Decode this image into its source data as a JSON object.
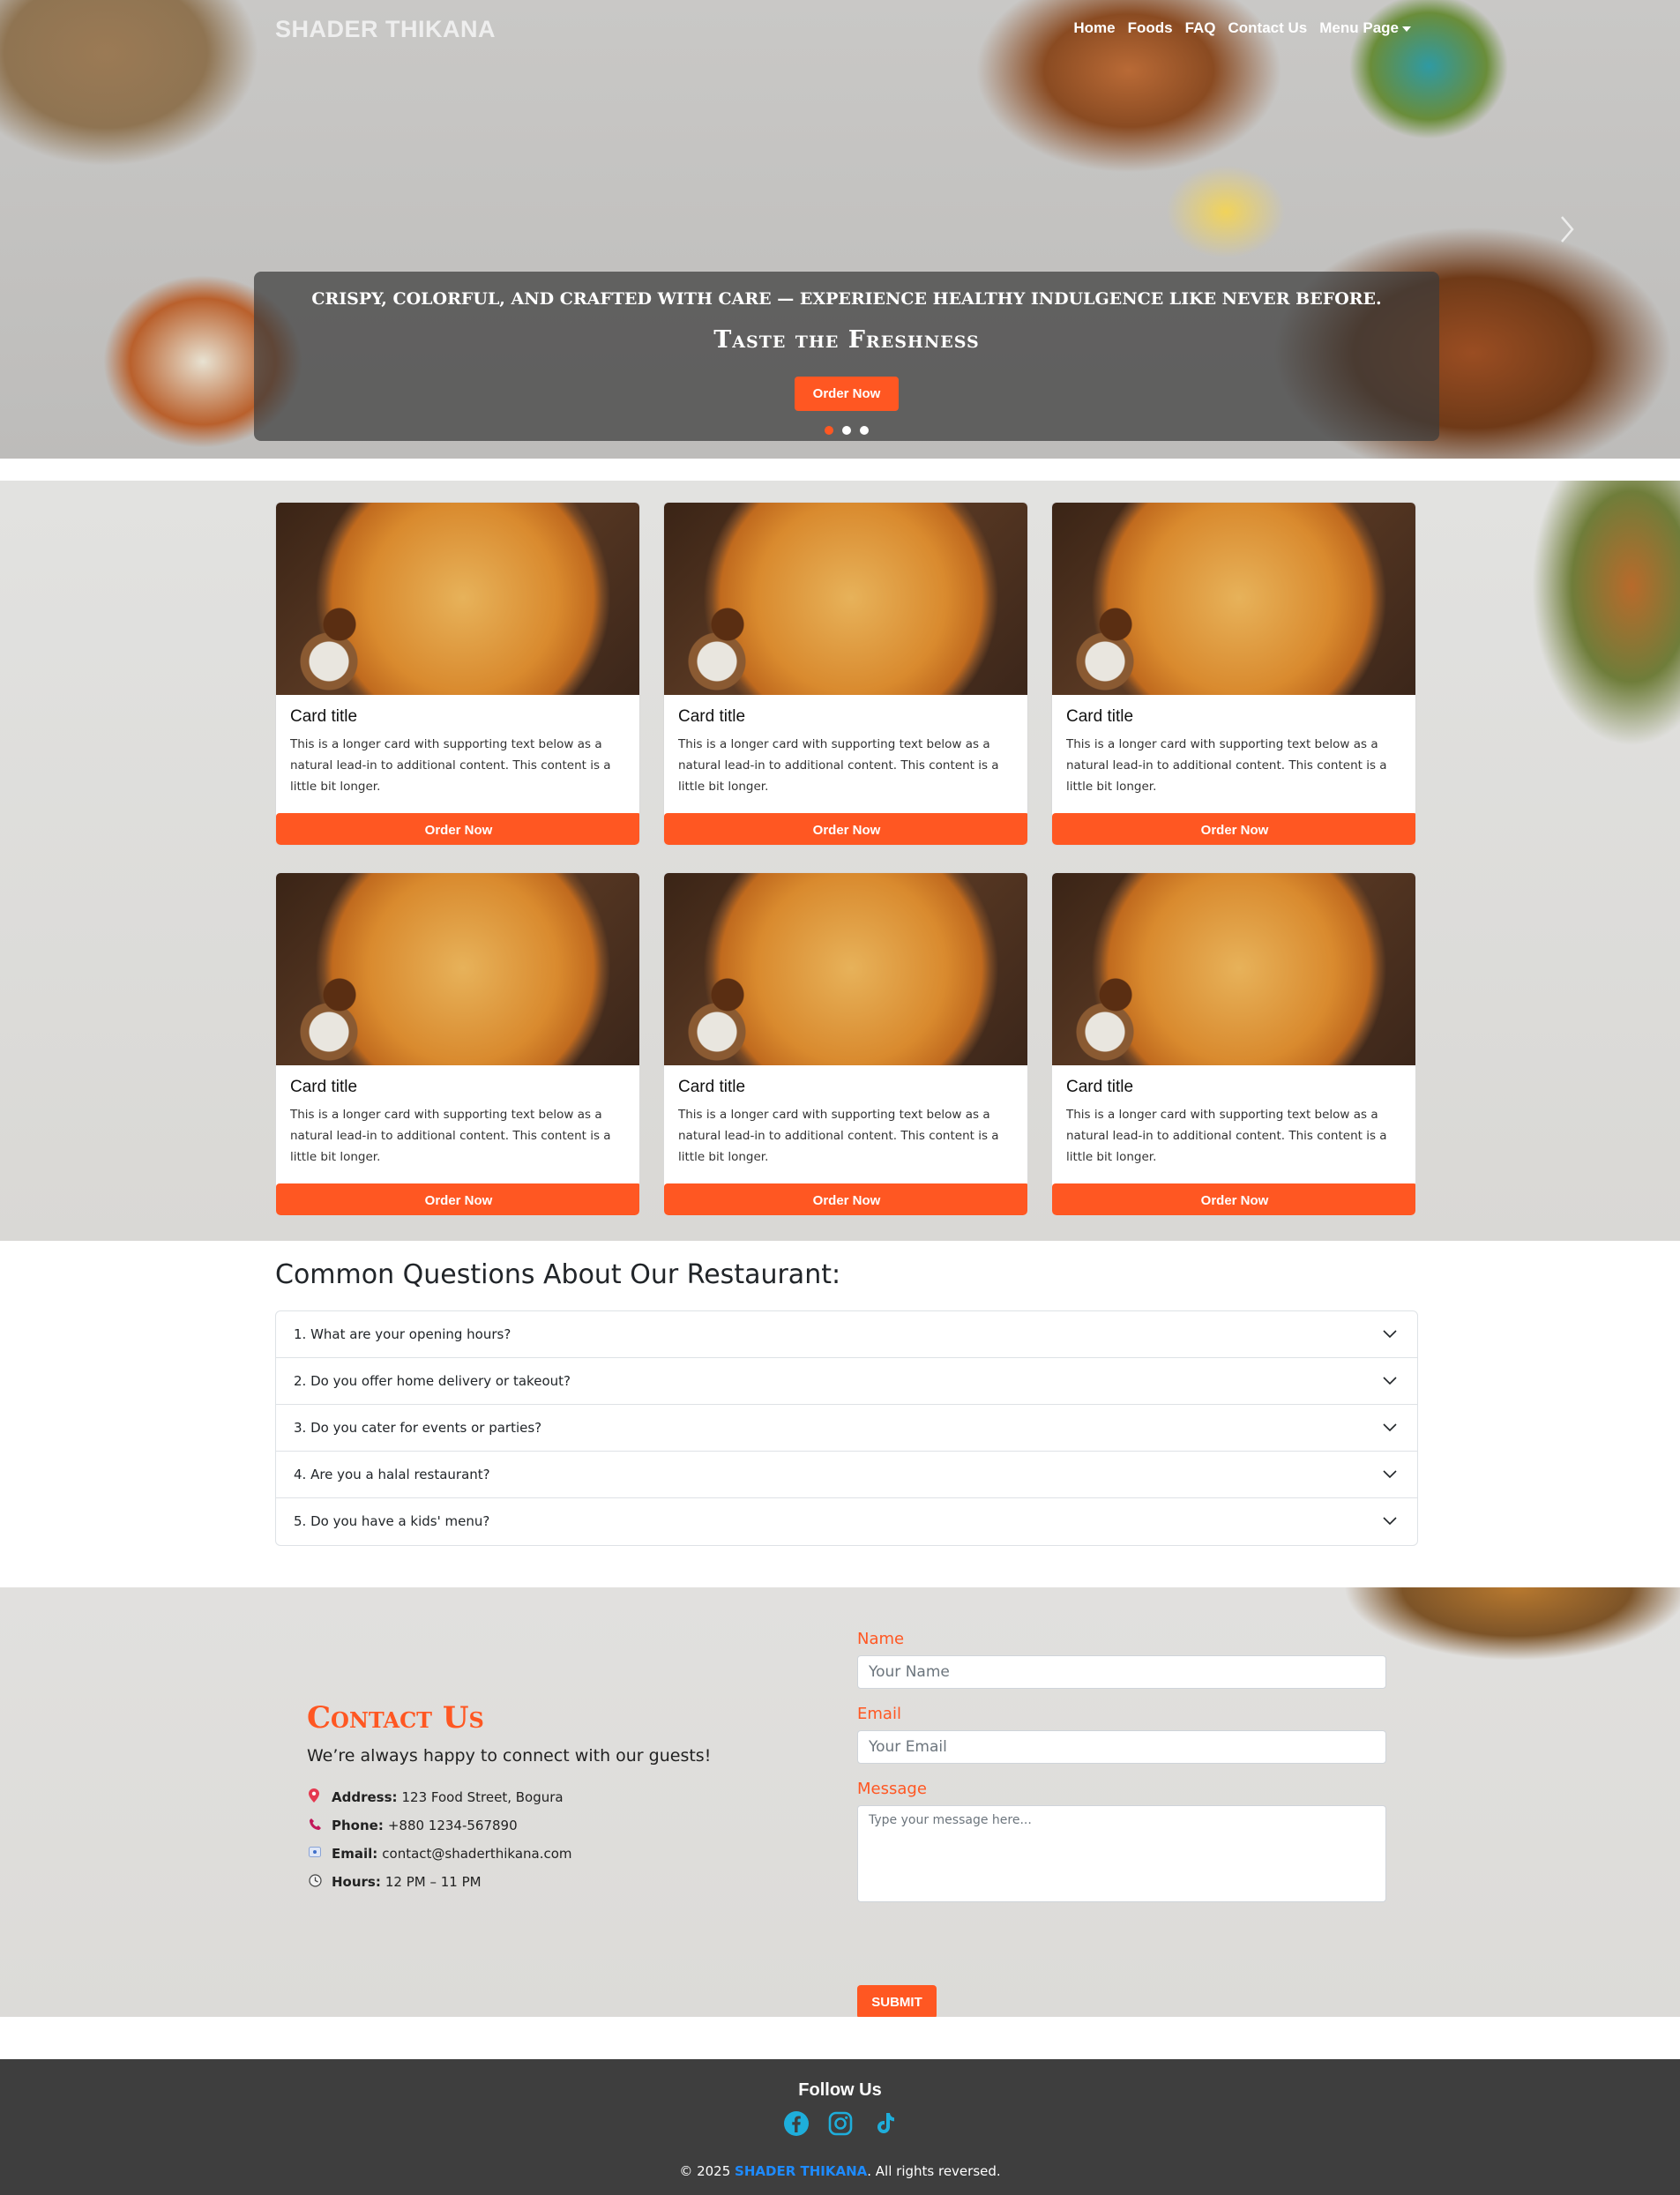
{
  "brand": "SHADER THIKANA",
  "nav": {
    "links": [
      "Home",
      "Foods",
      "FAQ",
      "Contact Us"
    ],
    "dropdown_label": "Menu Page"
  },
  "hero": {
    "caption_top": "CRISPY, COLORFUL, AND CRAFTED WITH CARE — EXPERIENCE HEALTHY INDULGENCE LIKE NEVER BEFORE.",
    "caption_title": "Taste the Freshness",
    "button": "Order Now",
    "active_slide": 1,
    "slide_count": 3
  },
  "cards": [
    {
      "title": "Card title",
      "text": "This is a longer card with supporting text below as a natural lead-in to additional content. This content is a little bit longer.",
      "button": "Order Now"
    },
    {
      "title": "Card title",
      "text": "This is a longer card with supporting text below as a natural lead-in to additional content. This content is a little bit longer.",
      "button": "Order Now"
    },
    {
      "title": "Card title",
      "text": "This is a longer card with supporting text below as a natural lead-in to additional content. This content is a little bit longer.",
      "button": "Order Now"
    },
    {
      "title": "Card title",
      "text": "This is a longer card with supporting text below as a natural lead-in to additional content. This content is a little bit longer.",
      "button": "Order Now"
    },
    {
      "title": "Card title",
      "text": "This is a longer card with supporting text below as a natural lead-in to additional content. This content is a little bit longer.",
      "button": "Order Now"
    },
    {
      "title": "Card title",
      "text": "This is a longer card with supporting text below as a natural lead-in to additional content. This content is a little bit longer.",
      "button": "Order Now"
    }
  ],
  "faq": {
    "heading": "Common Questions About Our Restaurant:",
    "questions": [
      "1. What are your opening hours?",
      "2. Do you offer home delivery or takeout?",
      "3. Do you cater for events or parties?",
      "4. Are you a halal restaurant?",
      "5. Do you have a kids' menu?"
    ]
  },
  "contact": {
    "title": "Contact Us",
    "subtitle": "We’re always happy to connect with our guests!",
    "info": [
      {
        "icon": "pin-icon",
        "label": "Address:",
        "value": "123 Food Street, Bogura"
      },
      {
        "icon": "phone-icon",
        "label": "Phone:",
        "value": "+880 1234-567890"
      },
      {
        "icon": "email-icon",
        "label": "Email:",
        "value": "contact@shaderthikana.com"
      },
      {
        "icon": "clock-icon",
        "label": "Hours:",
        "value": "12 PM – 11 PM"
      }
    ],
    "form": {
      "name_label": "Name",
      "name_placeholder": "Your Name",
      "email_label": "Email",
      "email_placeholder": "Your Email",
      "message_label": "Message",
      "message_placeholder": "Type your message here...",
      "submit": "SUBMIT"
    }
  },
  "footer": {
    "follow": "Follow Us",
    "social_icons": [
      "facebook-icon",
      "instagram-icon",
      "tiktok-icon"
    ],
    "copyright_prefix": "© 2025 ",
    "copyright_brand": "SHADER THIKANA",
    "copyright_suffix": ". All rights reversed."
  },
  "colors": {
    "accent": "#ff5722",
    "footer_bg": "#3e3e3e",
    "social": "#1eaedb",
    "copyright_brand": "#1e8bff"
  }
}
